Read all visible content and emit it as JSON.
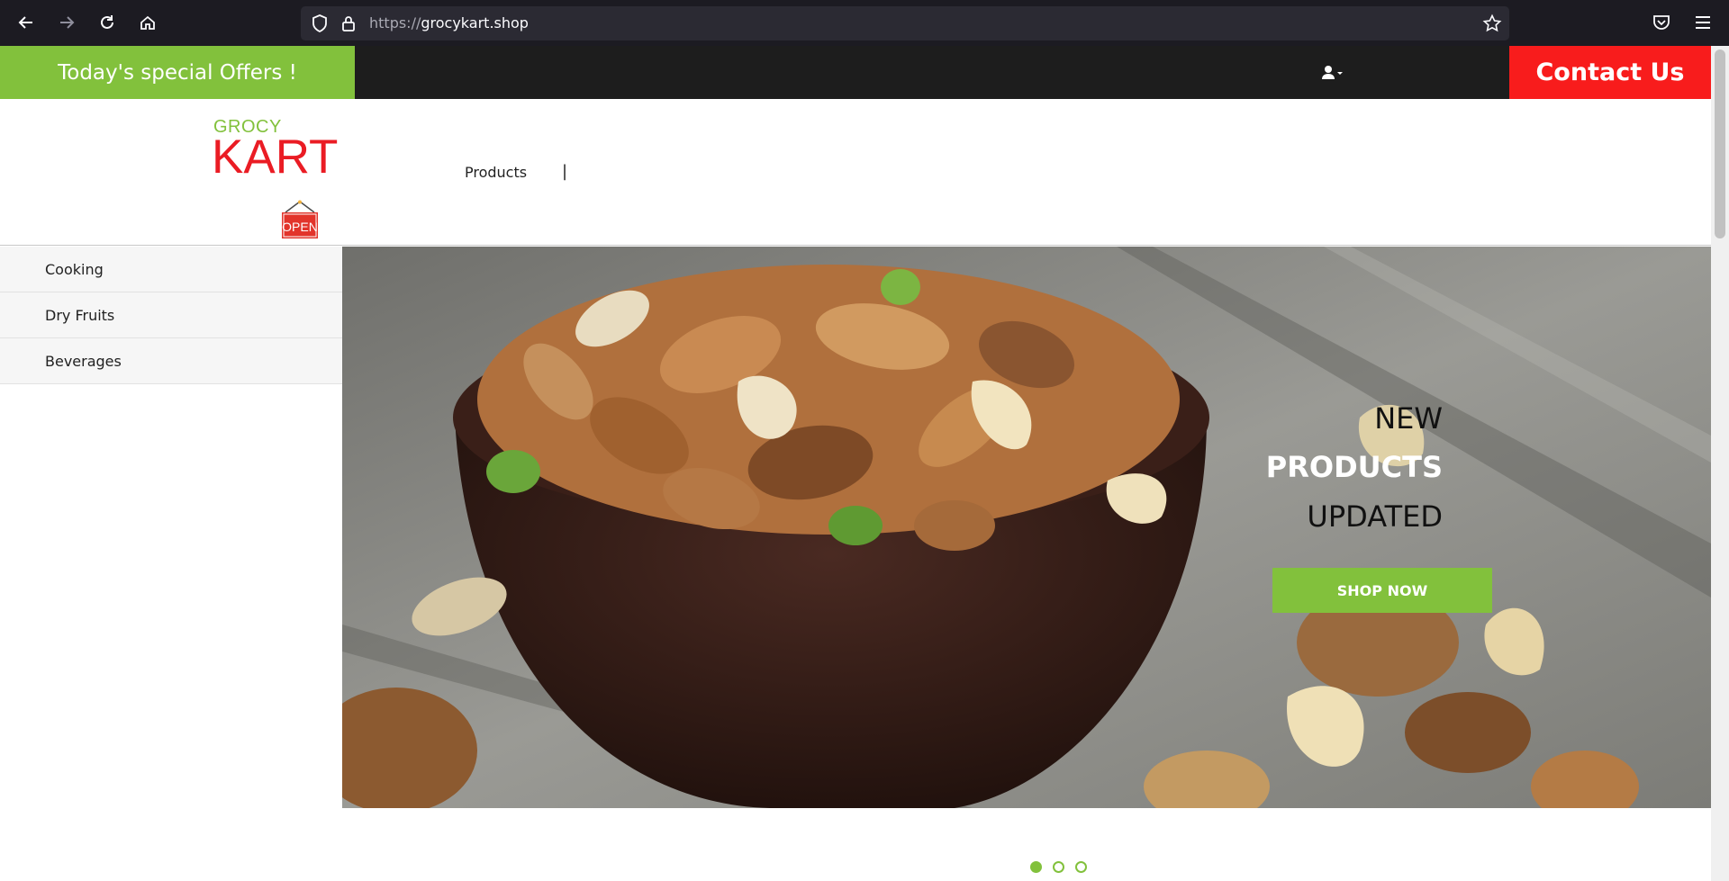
{
  "browser": {
    "url_protocol": "https://",
    "url_domain": "grocykart.shop"
  },
  "topbar": {
    "offers_label": "Today's special Offers !",
    "contact_label": "Contact Us"
  },
  "logo": {
    "line1": "GROCY",
    "line2": "KART",
    "sign": "OPEN"
  },
  "nav": {
    "products_label": "Products",
    "separator": "|"
  },
  "sidebar": {
    "items": [
      {
        "label": "Cooking"
      },
      {
        "label": "Dry Fruits"
      },
      {
        "label": "Beverages"
      }
    ]
  },
  "hero": {
    "line1": "NEW",
    "line2": "PRODUCTS",
    "line3": "UPDATED",
    "button_label": "SHOP NOW"
  },
  "carousel": {
    "slide_count": 3,
    "active_index": 0
  },
  "colors": {
    "brand_green": "#82c13c",
    "brand_red": "#f81c1c",
    "dark_strip": "#1d1d1d"
  }
}
